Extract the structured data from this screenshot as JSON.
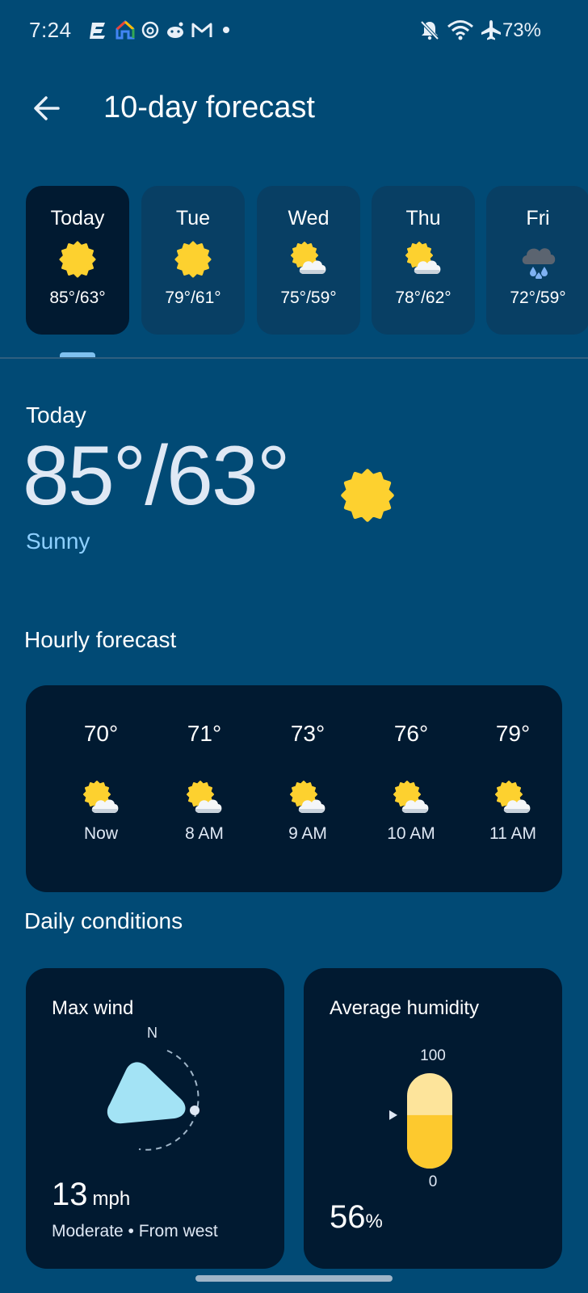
{
  "status_bar": {
    "time": "7:24",
    "battery": "73%",
    "icons": [
      "notification-e-icon",
      "google-home-icon",
      "threads-icon",
      "reddit-icon",
      "gmail-icon",
      "dot-icon",
      "bell-off-icon",
      "wifi-icon",
      "airplane-icon"
    ]
  },
  "header": {
    "title": "10-day forecast",
    "back_icon": "arrow-back-icon"
  },
  "days": [
    {
      "name": "Today",
      "temps": "85°/63°",
      "icon": "sunny-icon",
      "selected": true
    },
    {
      "name": "Tue",
      "temps": "79°/61°",
      "icon": "sunny-icon",
      "selected": false
    },
    {
      "name": "Wed",
      "temps": "75°/59°",
      "icon": "partly-cloudy-icon",
      "selected": false
    },
    {
      "name": "Thu",
      "temps": "78°/62°",
      "icon": "partly-cloudy-icon",
      "selected": false
    },
    {
      "name": "Fri",
      "temps": "72°/59°",
      "icon": "rain-cloud-icon",
      "selected": false
    }
  ],
  "today": {
    "label": "Today",
    "temps": "85°/63°",
    "condition": "Sunny",
    "icon": "sunny-icon"
  },
  "hourly": {
    "heading": "Hourly forecast",
    "items": [
      {
        "temp": "70°",
        "label": "Now",
        "icon": "partly-cloudy-icon"
      },
      {
        "temp": "71°",
        "label": "8 AM",
        "icon": "partly-cloudy-icon"
      },
      {
        "temp": "73°",
        "label": "9 AM",
        "icon": "partly-cloudy-icon"
      },
      {
        "temp": "76°",
        "label": "10 AM",
        "icon": "partly-cloudy-icon"
      },
      {
        "temp": "79°",
        "label": "11 AM",
        "icon": "partly-cloudy-icon"
      }
    ]
  },
  "daily_conditions": {
    "heading": "Daily conditions",
    "wind": {
      "title": "Max wind",
      "compass_north": "N",
      "value": "13",
      "unit": "mph",
      "description": "Moderate • From west"
    },
    "humidity": {
      "title": "Average humidity",
      "max_label": "100",
      "min_label": "0",
      "value": "56",
      "unit": "%",
      "level_percent": 56
    }
  },
  "colors": {
    "background": "#014a75",
    "card_dark": "#011a31",
    "card_day": "#083f64",
    "accent_blue": "#8ed0ff",
    "sun_yellow": "#fdd12f"
  }
}
